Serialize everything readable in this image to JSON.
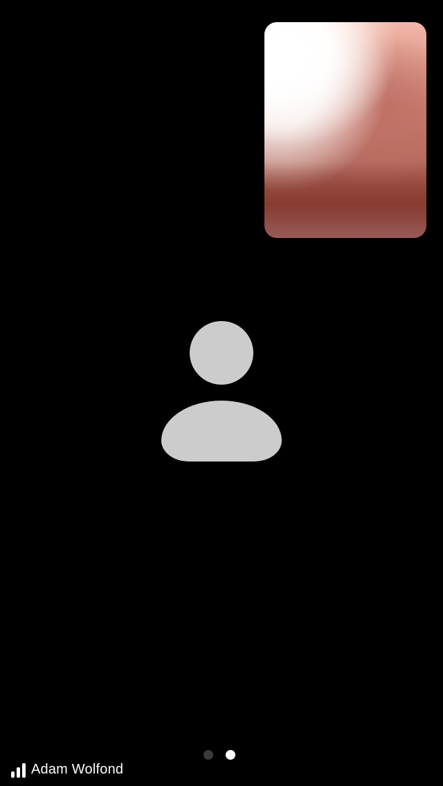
{
  "call": {
    "caller_name": "Adam Wolfond"
  },
  "pager": {
    "page_count": 2,
    "current_page": 2
  },
  "icons": {
    "avatar": "person-placeholder-icon",
    "signal": "signal-strength-icon"
  },
  "colors": {
    "background": "#000000",
    "avatar": "#cccccc",
    "dot_active": "#ffffff",
    "dot_inactive": "#3a3a3a"
  }
}
